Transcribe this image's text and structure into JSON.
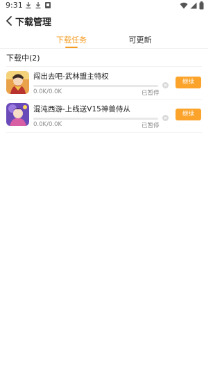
{
  "status_bar": {
    "time": "9:31",
    "icons": [
      "download-notification-icon",
      "download-notification-icon",
      "app-notification-icon",
      "wifi-icon",
      "signal-icon",
      "battery-icon"
    ]
  },
  "header": {
    "title": "下载管理",
    "back_icon": "chevron-left-icon"
  },
  "tabs": [
    {
      "label": "下载任务",
      "active": true
    },
    {
      "label": "可更新",
      "active": false
    }
  ],
  "colors": {
    "accent": "#f59b21",
    "button": "#fba32a"
  },
  "downloads": {
    "section_title": "下载中(2)",
    "items": [
      {
        "name": "闯出去吧-武林盟主特权",
        "size": "0.0K/0.0K",
        "status": "已暂停",
        "progress": 0,
        "action_label": "继续",
        "icon": "game-icon-warrior"
      },
      {
        "name": "混沌西游-上线送V15神兽侍从",
        "size": "0.0K/0.0K",
        "status": "已暂停",
        "progress": 0,
        "action_label": "继续",
        "icon": "game-icon-mage"
      }
    ]
  }
}
